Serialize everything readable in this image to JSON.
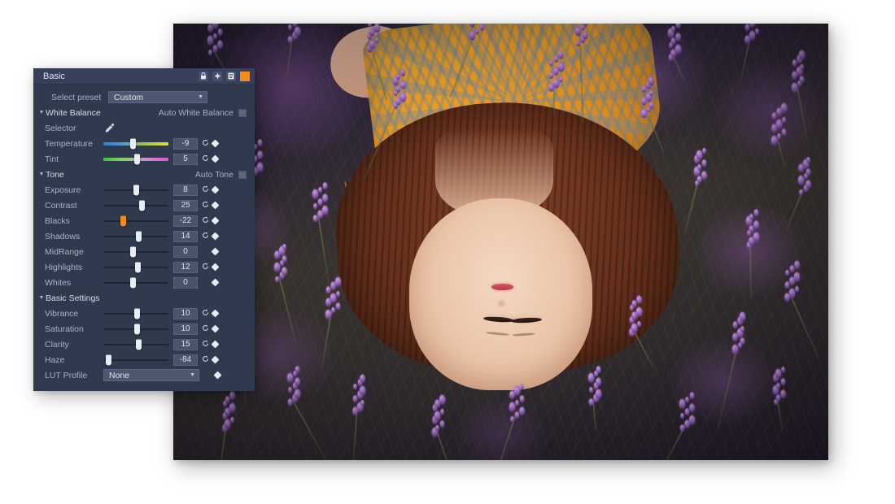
{
  "panel": {
    "title": "Basic",
    "title_icons": [
      "lock-icon",
      "move-icon",
      "copy-icon",
      "close-icon"
    ],
    "preset": {
      "label": "Select preset",
      "value": "Custom"
    },
    "sections": [
      {
        "name": "White Balance",
        "auto_label": "Auto White Balance",
        "auto_checked": false,
        "rows": [
          {
            "label": "Selector",
            "type": "picker",
            "icon": "eyedropper-icon"
          },
          {
            "label": "Temperature",
            "type": "slider",
            "value": "-9",
            "pos": 45,
            "gradient": "temp",
            "reset": true
          },
          {
            "label": "Tint",
            "type": "slider",
            "value": "5",
            "pos": 52,
            "gradient": "tint",
            "reset": true
          }
        ]
      },
      {
        "name": "Tone",
        "auto_label": "Auto Tone",
        "auto_checked": false,
        "rows": [
          {
            "label": "Exposure",
            "type": "slider",
            "value": "8",
            "pos": 51,
            "reset": true
          },
          {
            "label": "Contrast",
            "type": "slider",
            "value": "25",
            "pos": 59,
            "reset": true
          },
          {
            "label": "Blacks",
            "type": "slider",
            "value": "-22",
            "pos": 30,
            "reset": true,
            "accent": true
          },
          {
            "label": "Shadows",
            "type": "slider",
            "value": "14",
            "pos": 54,
            "reset": true
          },
          {
            "label": "MidRange",
            "type": "slider",
            "value": "0",
            "pos": 46,
            "reset": false
          },
          {
            "label": "Highlights",
            "type": "slider",
            "value": "12",
            "pos": 53,
            "reset": true
          },
          {
            "label": "Whites",
            "type": "slider",
            "value": "0",
            "pos": 46,
            "reset": false
          }
        ]
      },
      {
        "name": "Basic Settings",
        "auto_label": "",
        "auto_checked": false,
        "rows": [
          {
            "label": "Vibrance",
            "type": "slider",
            "value": "10",
            "pos": 52,
            "reset": true
          },
          {
            "label": "Saturation",
            "type": "slider",
            "value": "10",
            "pos": 52,
            "reset": true
          },
          {
            "label": "Clarity",
            "type": "slider",
            "value": "15",
            "pos": 54,
            "reset": true
          },
          {
            "label": "Haze",
            "type": "slider",
            "value": "-84",
            "pos": 8,
            "reset": true
          },
          {
            "label": "LUT Profile",
            "type": "dropdown",
            "value": "None"
          }
        ]
      }
    ]
  },
  "photo": {
    "description": "Overhead portrait of a woman lying in a lavender field, image oriented upside down",
    "alt": "woman-in-lavender-field"
  },
  "colors": {
    "panel_bg": "#303a4e",
    "panel_title_bg": "#36405a",
    "accent_orange": "#f08c21",
    "text": "#c3cada",
    "value_bg": "#49536c",
    "track": "#1f2636",
    "handle": "#e8ecf4"
  }
}
